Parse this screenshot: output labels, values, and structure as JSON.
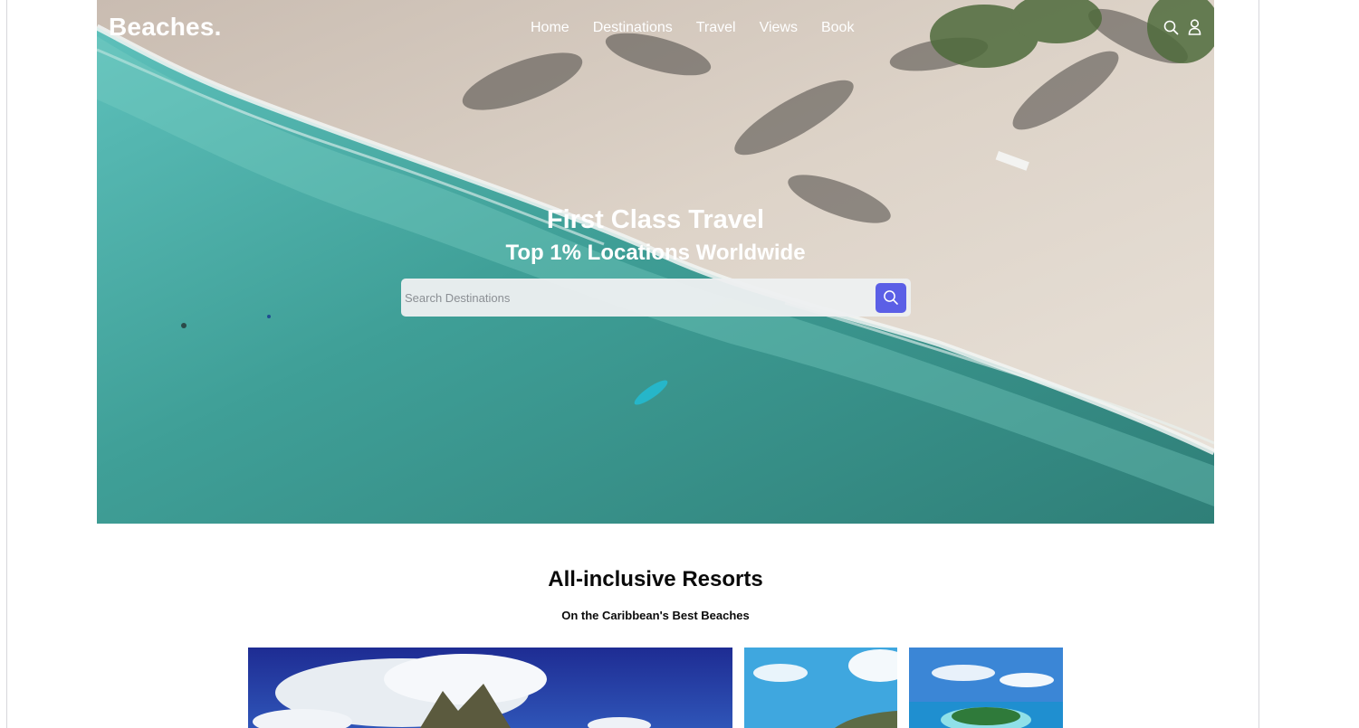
{
  "header": {
    "logo": "Beaches.",
    "nav": [
      "Home",
      "Destinations",
      "Travel",
      "Views",
      "Book"
    ],
    "icons": [
      "search-icon",
      "user-icon"
    ]
  },
  "hero": {
    "title": "First Class Travel",
    "subtitle": "Top 1% Locations Worldwide",
    "search": {
      "placeholder": "Search Destinations"
    }
  },
  "section": {
    "title": "All-inclusive Resorts",
    "subtitle": "On the Caribbean's Best Beaches"
  },
  "colors": {
    "accent": "#5b5fe6",
    "sea": "#3f9c94",
    "sand": "#d9cfc3"
  }
}
